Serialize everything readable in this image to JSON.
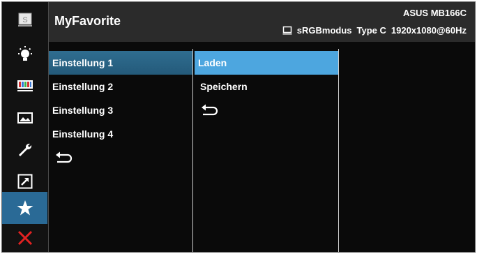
{
  "header": {
    "title": "MyFavorite",
    "model": "ASUS MB166C",
    "status": {
      "mode": "sRGBmodus",
      "input": "Type C",
      "resolution": "1920x1080@60Hz"
    }
  },
  "sidebar": {
    "items": [
      {
        "name": "splendid",
        "icon": "s-box-icon"
      },
      {
        "name": "blue-light-filter",
        "icon": "bulb-icon"
      },
      {
        "name": "color",
        "icon": "color-bars-icon"
      },
      {
        "name": "image",
        "icon": "picture-icon"
      },
      {
        "name": "system-setup",
        "icon": "wrench-icon"
      },
      {
        "name": "shortcut",
        "icon": "arrow-box-icon"
      },
      {
        "name": "myfavorite",
        "icon": "star-icon",
        "active": true
      },
      {
        "name": "exit",
        "icon": "x-icon"
      }
    ]
  },
  "menu": {
    "settings": [
      "Einstellung 1",
      "Einstellung 2",
      "Einstellung 3",
      "Einstellung 4"
    ],
    "actions": [
      "Laden",
      "Speichern"
    ]
  },
  "colors": {
    "active_sidebar": "#2a6a96",
    "highlight": "#4da6df",
    "exit_red": "#e32222"
  }
}
